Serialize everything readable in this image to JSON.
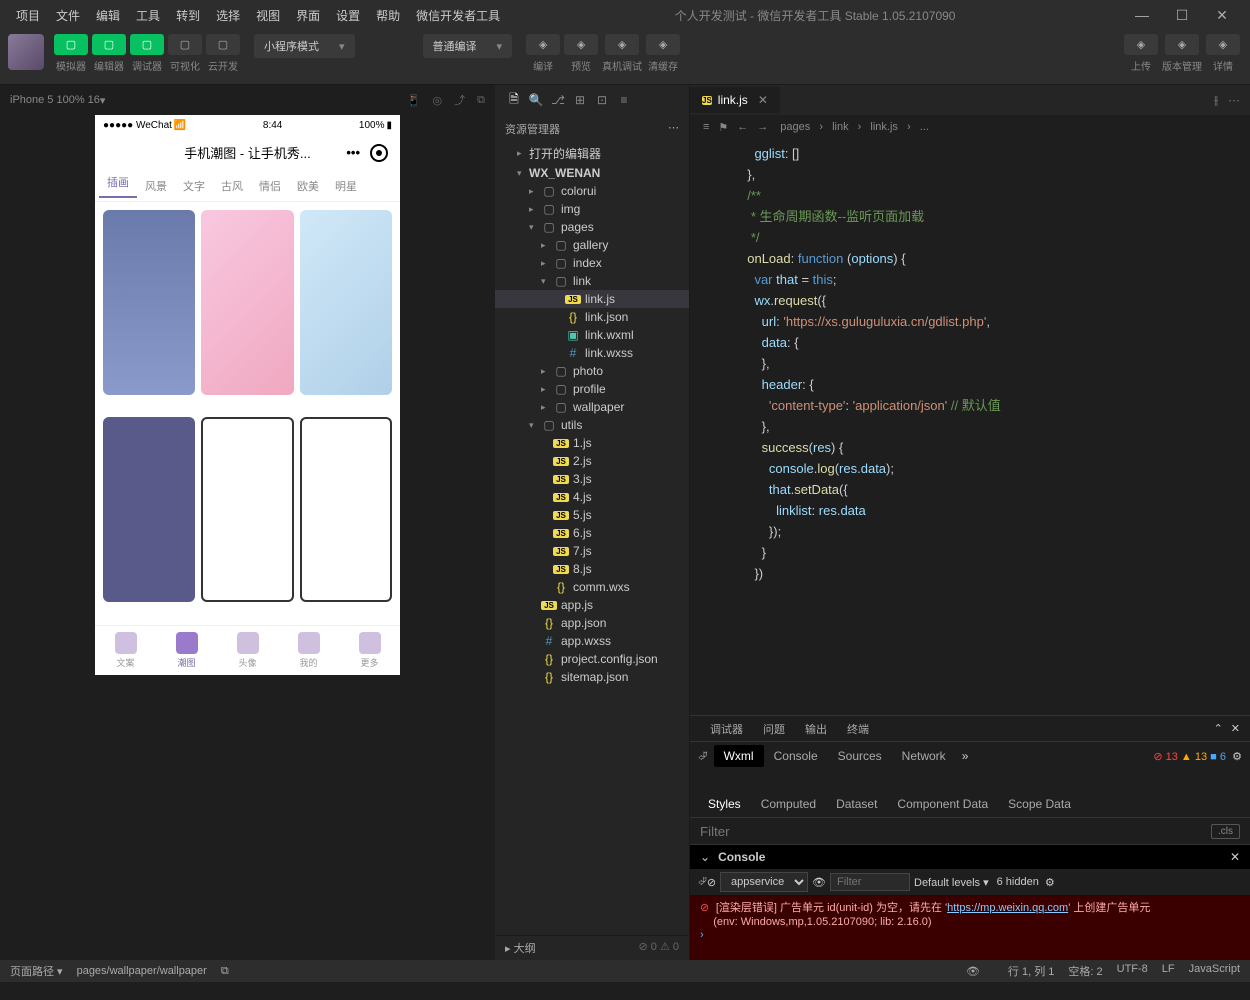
{
  "menu": [
    "项目",
    "文件",
    "编辑",
    "工具",
    "转到",
    "选择",
    "视图",
    "界面",
    "设置",
    "帮助",
    "微信开发者工具"
  ],
  "title": "个人开发测试 - 微信开发者工具 Stable 1.05.2107090",
  "toolbar": {
    "buttons": [
      {
        "label": "模拟器",
        "cls": "green"
      },
      {
        "label": "编辑器",
        "cls": "green"
      },
      {
        "label": "调试器",
        "cls": "green"
      },
      {
        "label": "可视化",
        "cls": "gray"
      },
      {
        "label": "云开发",
        "cls": "gray"
      }
    ],
    "mode": "小程序模式",
    "compile": "普通编译",
    "actions": [
      "编译",
      "预览",
      "真机调试",
      "清缓存"
    ],
    "right": [
      "上传",
      "版本管理",
      "详情"
    ]
  },
  "sim": {
    "device": "iPhone 5 100% 16",
    "arrow": "▾"
  },
  "phone": {
    "carrier": "●●●●● WeChat",
    "wifi": "📶",
    "time": "8:44",
    "bat": "100%",
    "title": "手机潮图 - 让手机秀...",
    "tabs": [
      "插画",
      "风景",
      "文字",
      "古风",
      "情侣",
      "欧美",
      "明星"
    ],
    "bottom": [
      "文案",
      "潮图",
      "头像",
      "我的",
      "更多"
    ]
  },
  "explorer": {
    "title": "资源管理器",
    "sections": {
      "open": "打开的编辑器",
      "proj": "WX_WENAN"
    },
    "tree": [
      {
        "l": "colorui",
        "t": "folder",
        "i": 2
      },
      {
        "l": "img",
        "t": "folder",
        "i": 2
      },
      {
        "l": "pages",
        "t": "folder",
        "i": 2,
        "open": true
      },
      {
        "l": "gallery",
        "t": "folder",
        "i": 3
      },
      {
        "l": "index",
        "t": "folder",
        "i": 3
      },
      {
        "l": "link",
        "t": "folder",
        "i": 3,
        "open": true
      },
      {
        "l": "link.js",
        "t": "js",
        "i": 4,
        "sel": true
      },
      {
        "l": "link.json",
        "t": "json",
        "i": 4
      },
      {
        "l": "link.wxml",
        "t": "wxml",
        "i": 4
      },
      {
        "l": "link.wxss",
        "t": "wxss",
        "i": 4
      },
      {
        "l": "photo",
        "t": "folder",
        "i": 3
      },
      {
        "l": "profile",
        "t": "folder",
        "i": 3
      },
      {
        "l": "wallpaper",
        "t": "folder",
        "i": 3
      },
      {
        "l": "utils",
        "t": "folder",
        "i": 2,
        "open": true
      },
      {
        "l": "1.js",
        "t": "js",
        "i": 3
      },
      {
        "l": "2.js",
        "t": "js",
        "i": 3
      },
      {
        "l": "3.js",
        "t": "js",
        "i": 3
      },
      {
        "l": "4.js",
        "t": "js",
        "i": 3
      },
      {
        "l": "5.js",
        "t": "js",
        "i": 3
      },
      {
        "l": "6.js",
        "t": "js",
        "i": 3
      },
      {
        "l": "7.js",
        "t": "js",
        "i": 3
      },
      {
        "l": "8.js",
        "t": "js",
        "i": 3
      },
      {
        "l": "comm.wxs",
        "t": "json",
        "i": 3
      },
      {
        "l": "app.js",
        "t": "js",
        "i": 2
      },
      {
        "l": "app.json",
        "t": "json",
        "i": 2
      },
      {
        "l": "app.wxss",
        "t": "wxss",
        "i": 2
      },
      {
        "l": "project.config.json",
        "t": "json",
        "i": 2
      },
      {
        "l": "sitemap.json",
        "t": "json",
        "i": 2
      }
    ],
    "outline": "大纲",
    "outstat": "⊘ 0 ⚠ 0"
  },
  "editor": {
    "tab": "link.js",
    "crumbs": [
      "pages",
      "link",
      "link.js",
      "..."
    ],
    "lines": [
      {
        "t": "    gglist: []",
        "cls": ""
      },
      {
        "t": "  },",
        "cls": ""
      },
      {
        "t": "",
        "cls": ""
      },
      {
        "t": "  /**",
        "cls": "cm"
      },
      {
        "t": "   * 生命周期函数--监听页面加载",
        "cls": "cm"
      },
      {
        "t": "   */",
        "cls": "cm"
      },
      {
        "t": "  onLoad: function (options) {",
        "cls": "fn"
      },
      {
        "t": "    var that = this;",
        "cls": "kw"
      },
      {
        "t": "    wx.request({",
        "cls": "fn"
      },
      {
        "t": "      url: 'https://xs.guluguluxia.cn/gdlist.php',",
        "cls": "str"
      },
      {
        "t": "      data: {",
        "cls": "pr"
      },
      {
        "t": "      },",
        "cls": ""
      },
      {
        "t": "      header: {",
        "cls": "pr"
      },
      {
        "t": "        'content-type': 'application/json' // 默认值",
        "cls": "str"
      },
      {
        "t": "      },",
        "cls": ""
      },
      {
        "t": "      success(res) {",
        "cls": "fn"
      },
      {
        "t": "        console.log(res.data);",
        "cls": "fn"
      },
      {
        "t": "        that.setData({",
        "cls": "fn"
      },
      {
        "t": "          linklist: res.data",
        "cls": "pr"
      },
      {
        "t": "        });",
        "cls": ""
      },
      {
        "t": "      }",
        "cls": ""
      },
      {
        "t": "    })",
        "cls": ""
      }
    ]
  },
  "devtools": {
    "tabs": [
      "调试器",
      "问题",
      "输出",
      "终端"
    ],
    "subtabs": [
      "Wxml",
      "Console",
      "Sources",
      "Network"
    ],
    "stats": {
      "err": "13",
      "warn": "13",
      "info": "6"
    },
    "styletabs": [
      "Styles",
      "Computed",
      "Dataset",
      "Component Data",
      "Scope Data"
    ],
    "filter": "Filter",
    "cls": ".cls",
    "console": {
      "title": "Console",
      "scope": "appservice",
      "filter": "Filter",
      "levels": "Default levels",
      "hidden": "6 hidden",
      "msg1": "[渲染层错误] 广告单元 id(unit-id) 为空，请先在 '",
      "msg1url": "https://mp.weixin.qq.com",
      "msg1b": "' 上创建广告单元",
      "msg2": "(env: Windows,mp,1.05.2107090; lib: 2.16.0)"
    }
  },
  "statusbar": {
    "path": "页面路径",
    "pathval": "pages/wallpaper/wallpaper",
    "right": [
      "行 1, 列 1",
      "空格: 2",
      "UTF-8",
      "LF",
      "JavaScript"
    ]
  }
}
